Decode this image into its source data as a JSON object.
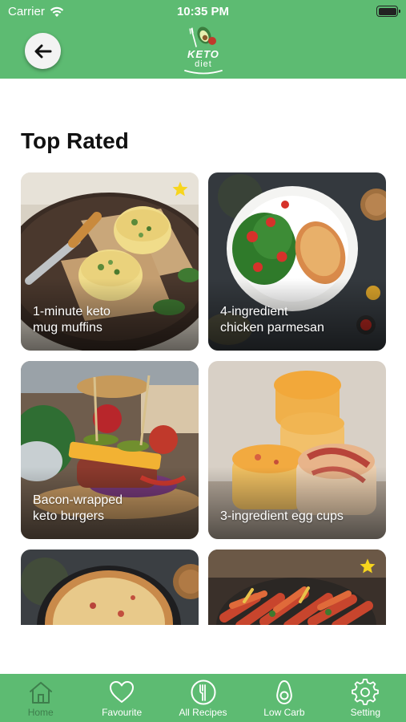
{
  "status": {
    "carrier": "Carrier",
    "time": "10:35 PM"
  },
  "header": {
    "logo_line1": "KETO",
    "logo_line2": "diet"
  },
  "main": {
    "section_title": "Top Rated"
  },
  "recipes": [
    {
      "title": "1-minute keto\nmug muffins",
      "starred": true
    },
    {
      "title": "4-ingredient\nchicken parmesan",
      "starred": false
    },
    {
      "title": "Bacon-wrapped\nketo burgers",
      "starred": false
    },
    {
      "title": "3-ingredient egg cups",
      "starred": false
    },
    {
      "title": "",
      "starred": false
    },
    {
      "title": "",
      "starred": true
    }
  ],
  "tabbar": {
    "items": [
      {
        "label": "Home",
        "icon": "home-icon",
        "active": true
      },
      {
        "label": "Favourite",
        "icon": "heart-icon",
        "active": false
      },
      {
        "label": "All Recipes",
        "icon": "fork-icon",
        "active": false
      },
      {
        "label": "Low Carb",
        "icon": "avocado-icon",
        "active": false
      },
      {
        "label": "Setting",
        "icon": "gear-icon",
        "active": false
      }
    ]
  },
  "colors": {
    "brand_green": "#5dbb72",
    "active_tab": "#3e7e4c",
    "star": "#f7d51d"
  }
}
